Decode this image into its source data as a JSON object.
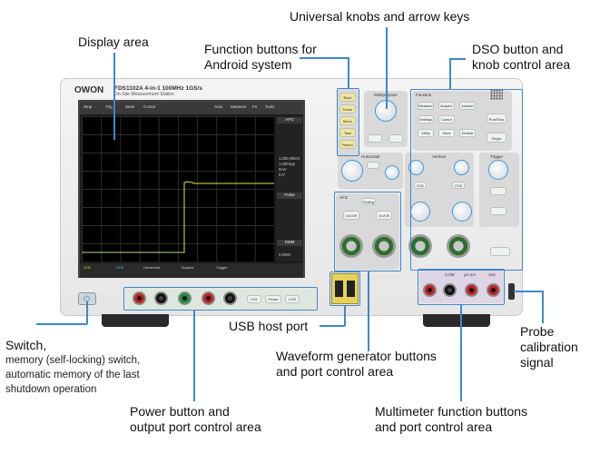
{
  "labels": {
    "display_area": "Display area",
    "universal_knobs": "Universal knobs and arrow keys",
    "function_buttons_line1": "Function buttons for",
    "function_buttons_line2": "Android system",
    "dso_line1": "DSO button and",
    "dso_line2": "knob control area",
    "switch_title": "Switch,",
    "switch_desc_line1": "memory (self-locking) switch,",
    "switch_desc_line2": "automatic memory of the last",
    "switch_desc_line3": "shutdown operation",
    "usb_host": "USB host port",
    "waveform_line1": "Waveform generator buttons",
    "waveform_line2": "and port control area",
    "probe_line1": "Probe",
    "probe_line2": "calibration",
    "probe_line3": "signal",
    "power_line1": "Power button and",
    "power_line2": "output port control area",
    "multimeter_line1": "Multimeter function buttons",
    "multimeter_line2": "and port control area"
  },
  "device": {
    "brand": "OWON",
    "model": "FDS1102A  4-in-1  100MHz  1GS/s",
    "model_sub": "On-Site Measurement Station",
    "screen": {
      "toolbar_items": [
        "Stop",
        "Trig",
        "Save",
        "Cursor",
        "Auto",
        "Measure",
        "Fn",
        "Tools"
      ],
      "right_tabs": [
        "AFG",
        "Pulse",
        "DMM"
      ],
      "right_values": [
        "1.000,00kHz",
        "1.000Vpp",
        "0mV",
        "0.0°",
        "0.0000"
      ],
      "bottom_items": [
        "CH1",
        "CH2",
        "Horizontal",
        "Acquire",
        "Trigger"
      ]
    },
    "sections": {
      "android": [
        "Back",
        "Home",
        "Menu",
        "Task",
        "Return"
      ],
      "multipurpose": "Multipurpose",
      "function": "Function",
      "function_buttons": [
        "Measure",
        "Acquire",
        "Autoset",
        "Settings",
        "Cursor",
        "Run/Stop",
        "Utility",
        "Save",
        "Default",
        "Single"
      ],
      "vertical": "Vertical",
      "horizontal": "Horizontal",
      "trigger": "Trigger",
      "afg": "AFG",
      "afg_buttons": [
        "Setting",
        "On/Off",
        "On/Off"
      ],
      "channel_labels": [
        "CH1",
        "CH2"
      ],
      "dmm": [
        "COM",
        "μA mA",
        "10A"
      ],
      "psu": [
        "CH1",
        "Power",
        "CH2"
      ]
    }
  }
}
